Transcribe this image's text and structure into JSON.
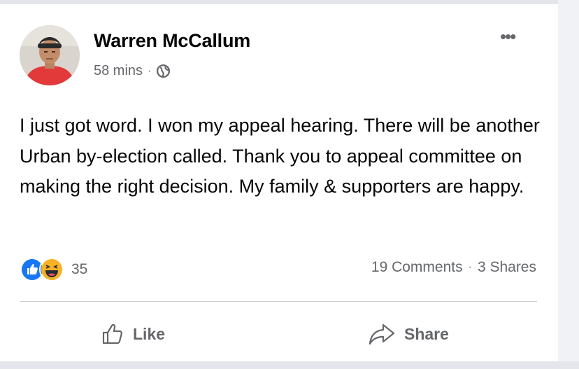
{
  "post": {
    "author": "Warren McCallum",
    "time": "58 mins",
    "meta_separator": "·",
    "audience_icon": "globe-icon",
    "more_icon": "ellipsis-icon",
    "more_label": "•••",
    "text": "I just got word. I won my appeal hearing. There will be another Urban by-election called. Thank you to appeal committee on making the right decision. My family & supporters are happy."
  },
  "reactions": {
    "icons": [
      "like-reaction-icon",
      "haha-reaction-icon"
    ],
    "count": "35"
  },
  "stats": {
    "comments": "19 Comments",
    "separator": "·",
    "shares": "3 Shares"
  },
  "actions": {
    "like_label": "Like",
    "like_icon": "thumbs-up-icon",
    "share_label": "Share",
    "share_icon": "share-arrow-icon"
  },
  "colors": {
    "text_primary": "#050505",
    "text_secondary": "#65676b",
    "like_blue": "#1877f2",
    "haha_yellow": "#f7b125",
    "avatar_shirt": "#e23a3a"
  }
}
